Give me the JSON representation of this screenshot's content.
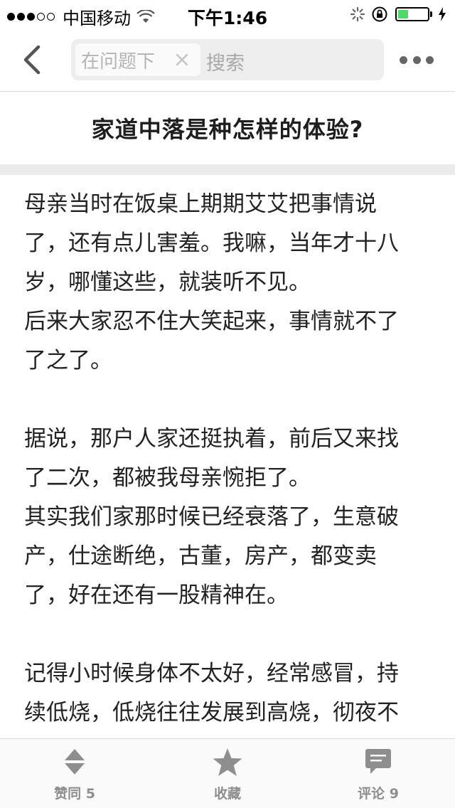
{
  "status_bar": {
    "carrier": "中国移动",
    "time": "下午1:46",
    "signal_full": 3,
    "signal_empty": 2,
    "battery_level": 0.35,
    "battery_color": "#4cd964"
  },
  "nav": {
    "back_icon": "chevron-left-icon",
    "scope_label": "在问题下",
    "search_placeholder": "搜索",
    "more_icon": "more-dots-icon"
  },
  "question": {
    "title": "家道中落是种怎样的体验?"
  },
  "answer": {
    "lines": [
      "母亲当时在饭桌上期期艾艾把事情说",
      "了，还有点儿害羞。我嘛，当年才十八",
      "岁，哪懂这些，就装听不见。",
      "后来大家忍不住大笑起来，事情就不了",
      "了之了。",
      "",
      "据说，那户人家还挺执着，前后又来找",
      "了二次，都被我母亲惋拒了。",
      "其实我们家那时候已经衰落了，生意破",
      "产，仕途断绝，古董，房产，都变卖",
      "了，好在还有一股精神在。",
      "",
      "记得小时候身体不太好，经常感冒，持",
      "续低烧，低烧往往发展到高烧，彻夜不"
    ]
  },
  "tab_bar": {
    "upvote_label": "赞同 5",
    "favorite_label": "收藏",
    "comment_label": "评论 9",
    "icon_color": "#8e8e8e"
  }
}
